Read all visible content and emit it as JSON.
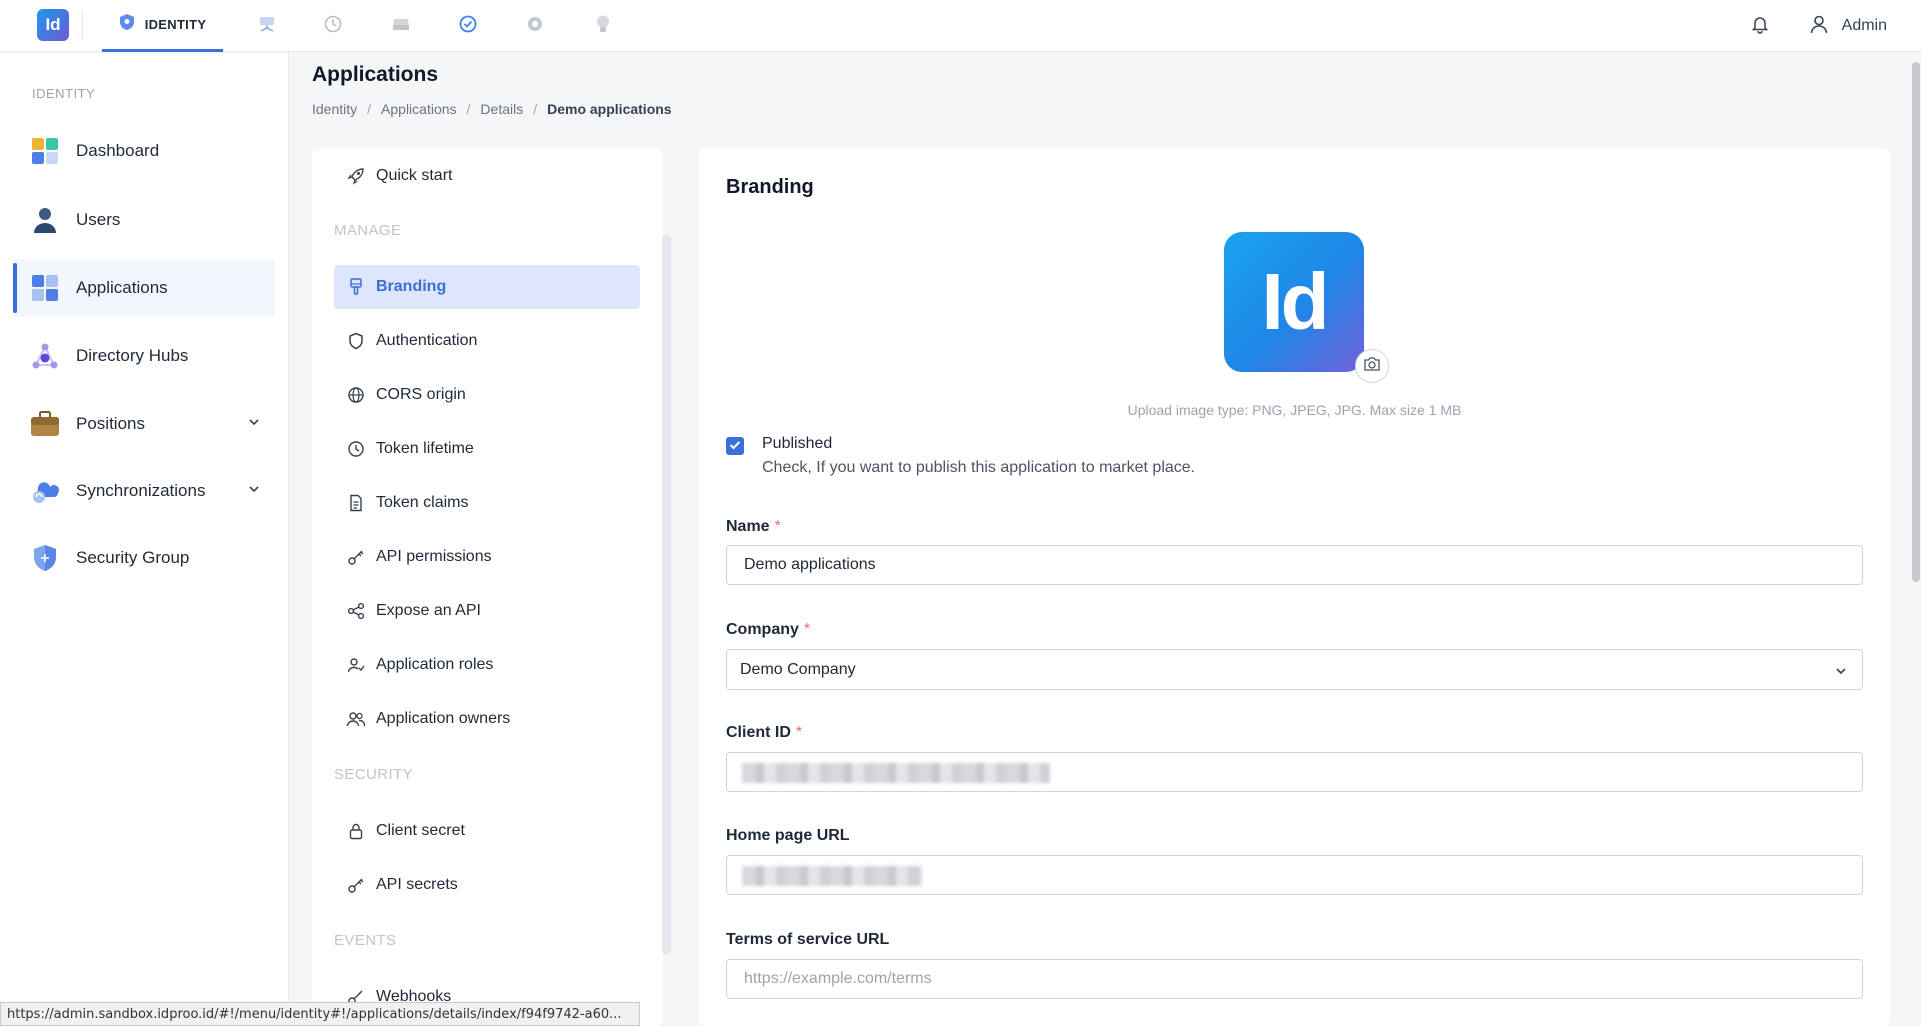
{
  "app": {
    "logo_text": "Id",
    "active_tab": "IDENTITY",
    "user": "Admin"
  },
  "icons": {
    "top_tabs": [
      "shield-icon",
      "network-icon",
      "history-icon",
      "storage-icon",
      "check-circle-icon",
      "gear-icon",
      "bulb-icon"
    ],
    "top_right": [
      "bell-icon",
      "user-icon"
    ]
  },
  "sidebar": {
    "section": "IDENTITY",
    "items": [
      {
        "label": "Dashboard"
      },
      {
        "label": "Users"
      },
      {
        "label": "Applications"
      },
      {
        "label": "Directory Hubs"
      },
      {
        "label": "Positions"
      },
      {
        "label": "Synchronizations"
      },
      {
        "label": "Security Group"
      }
    ]
  },
  "header": {
    "title": "Applications",
    "breadcrumb": [
      "Identity",
      "Applications",
      "Details",
      "Demo applications"
    ]
  },
  "menu": {
    "quick_start": "Quick start",
    "sections": {
      "manage": "MANAGE",
      "security": "SECURITY",
      "events": "EVENTS"
    },
    "manage_items": [
      "Branding",
      "Authentication",
      "CORS origin",
      "Token lifetime",
      "Token claims",
      "API permissions",
      "Expose an API",
      "Application roles",
      "Application owners"
    ],
    "security_items": [
      "Client secret",
      "API secrets"
    ],
    "events_items": [
      "Webhooks"
    ]
  },
  "branding": {
    "title": "Branding",
    "logo_text": "Id",
    "upload_hint": "Upload image type: PNG, JPEG, JPG. Max size 1 MB",
    "published_label": "Published",
    "published_help": "Check, If you want to publish this application to market place.",
    "fields": {
      "name_label": "Name",
      "name_value": "Demo applications",
      "company_label": "Company",
      "company_value": "Demo Company",
      "client_id_label": "Client ID",
      "home_url_label": "Home page URL",
      "terms_label": "Terms of service URL",
      "terms_placeholder": "https://example.com/terms",
      "required_mark": "*"
    }
  },
  "status_url": "https://admin.sandbox.idproo.id/#!/menu/identity#!/applications/details/index/f94f9742-a60..."
}
